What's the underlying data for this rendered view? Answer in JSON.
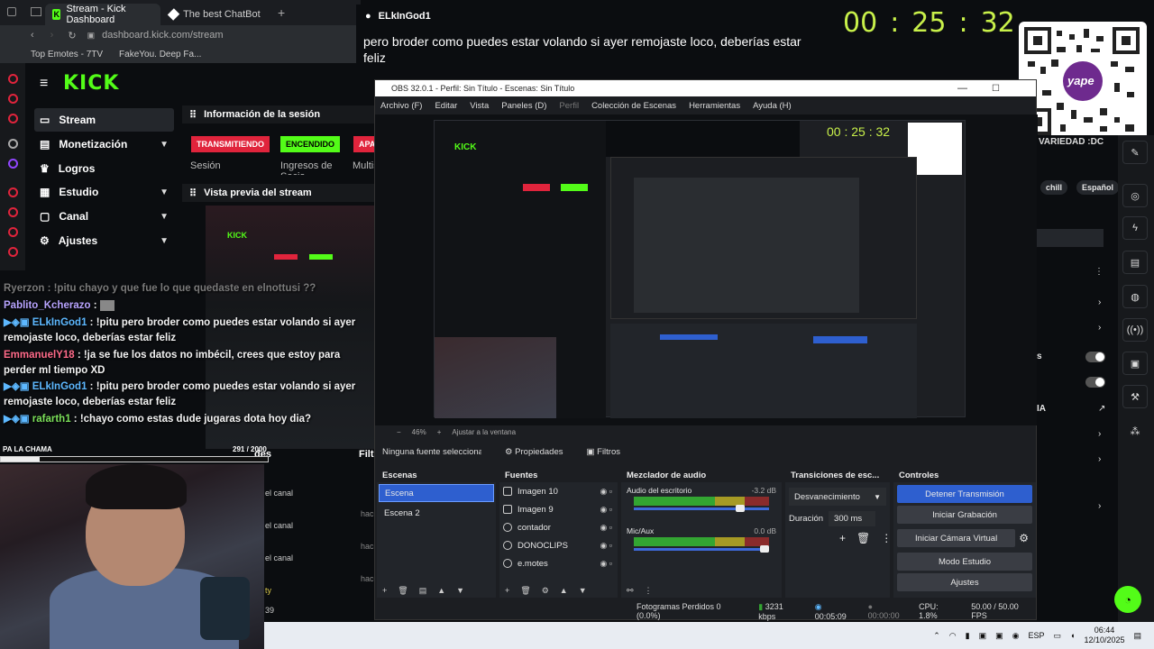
{
  "browser": {
    "tabs": [
      {
        "label": "Stream - Kick Dashboard"
      },
      {
        "label": "The best ChatBot and W"
      }
    ],
    "address": "dashboard.kick.com/stream",
    "bookmarks": [
      "Top Emotes - 7TV",
      "FakeYou. Deep Fa..."
    ]
  },
  "kick": {
    "logo": "KICK",
    "nav": [
      {
        "label": "Stream",
        "icon": "stream-icon",
        "chevron": false
      },
      {
        "label": "Monetización",
        "icon": "monetization-icon",
        "chevron": true
      },
      {
        "label": "Logros",
        "icon": "trophy-icon",
        "chevron": false
      },
      {
        "label": "Estudio",
        "icon": "studio-icon",
        "chevron": true
      },
      {
        "label": "Canal",
        "icon": "channel-icon",
        "chevron": true
      },
      {
        "label": "Ajustes",
        "icon": "gear-icon",
        "chevron": true
      }
    ],
    "session_header": "Información de la sesión",
    "badges": [
      {
        "label": "TRANSMITIENDO",
        "color": "#e0243c",
        "text_color": "#ffffff"
      },
      {
        "label": "ENCENDIDO",
        "color": "#53fc18",
        "text_color": "#000000"
      },
      {
        "label": "APAG",
        "color": "#e0243c",
        "text_color": "#ffffff"
      }
    ],
    "session_labels": [
      "Sesión",
      "Ingresos de Socio",
      "Multis"
    ],
    "preview_header": "Vista previa del stream",
    "dock_bits": [
      "des",
      "Filtr",
      "el canal",
      "hace",
      "el canal",
      "hace",
      "el canal",
      "hace",
      "ty",
      "39"
    ]
  },
  "chat": [
    {
      "user": "Ryerzon",
      "msg": ": !pitu chayo y que fue lo que quedaste en elnottusi ??",
      "faded": true,
      "user_color": "#8a8a8a"
    },
    {
      "user": "Pablito_Kcherazo",
      "msg": ":",
      "faded": false,
      "user_color": "#b8a4ff"
    },
    {
      "user": "ELkInGod1",
      "msg": ": !pitu pero broder como puedes estar volando si ayer remojaste loco, deberías estar feliz",
      "faded": false,
      "user_color": "#5db8ff"
    },
    {
      "user": "EmmanuelY18",
      "msg": ": !ja se fue los datos no imbécil, crees que estoy para perder ml tiempo XD",
      "faded": false,
      "user_color": "#ff6b8a"
    },
    {
      "user": "ELkInGod1",
      "msg": ": !pitu pero broder como puedes estar volando si ayer remojaste loco, deberías estar feliz",
      "faded": false,
      "user_color": "#5db8ff"
    },
    {
      "user": "rafarth1",
      "msg": ": !chayo como estas dude jugaras dota hoy dia?",
      "faded": false,
      "user_color": "#7be05a"
    }
  ],
  "webcam_bar": {
    "label": "PA LA CHAMA",
    "count": "291 / 2000",
    "progress": 0.145
  },
  "top": {
    "user": "ELkInGod1",
    "message": "pero broder como puedes estar volando si ayer remojaste loco, deberías estar feliz",
    "timer": [
      "00",
      ":",
      "25",
      ":",
      "32"
    ]
  },
  "qr": {
    "label": "yape"
  },
  "obs": {
    "title": "OBS 32.0.1 - Perfil: Sin Título - Escenas: Sin Título",
    "menu": [
      "Archivo (F)",
      "Editar",
      "Vista",
      "Paneles (D)",
      "Perfil",
      "Colección de Escenas",
      "Herramientas",
      "Ayuda (H)"
    ],
    "zoom": "46%",
    "fit": "Ajustar a la ventana",
    "no_source": "Ninguna fuente seleccionad",
    "properties": "Propiedades",
    "filters": "Filtros",
    "docks": {
      "scenes": {
        "title": "Escenas",
        "items": [
          "Escena",
          "Escena 2"
        ],
        "selected": 0
      },
      "sources": {
        "title": "Fuentes",
        "items": [
          "Imagen 10",
          "Imagen 9",
          "contador",
          "DONOCLIPS",
          "e.motes"
        ]
      },
      "mixer": {
        "title": "Mezclador de audio",
        "channels": [
          {
            "name": "Audio del escritorio",
            "db": "-3.2 dB",
            "level": 0.82
          },
          {
            "name": "Mic/Aux",
            "db": "0.0 dB",
            "level": 1.0
          }
        ]
      },
      "transitions": {
        "title": "Transiciones de esc...",
        "type": "Desvanecimiento",
        "duration_label": "Duración",
        "duration": "300 ms"
      },
      "controls": {
        "title": "Controles",
        "buttons": [
          "Detener Transmisión",
          "Iniciar Grabación",
          "Iniciar Cámara Virtual",
          "Modo Estudio",
          "Ajustes"
        ]
      }
    },
    "status": {
      "dropped": "Fotogramas Perdidos 0 (0.0%)",
      "bitrate": "3231 kbps",
      "stream_time": "00:05:09",
      "rec_time": "00:00:00",
      "cpu": "CPU: 1.8%",
      "fps": "50.00 / 50.00 FPS"
    }
  },
  "right": {
    "category": "VARIEDAD :DC",
    "tags": [
      "chill",
      "Español"
    ],
    "misc": [
      "s",
      "IA"
    ]
  },
  "taskbar": {
    "lang": "ESP",
    "time": "06:44",
    "date": "12/10/2025"
  }
}
